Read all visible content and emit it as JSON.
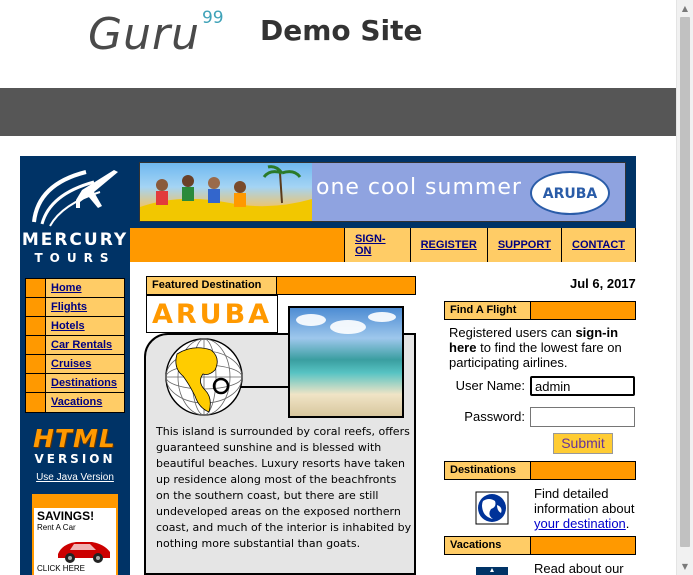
{
  "header": {
    "logo_word": "Guru",
    "logo_sup": "99",
    "site_title": "Demo Site"
  },
  "mercury": {
    "brand_line1": "MERCURY",
    "brand_line2": "TOURS",
    "banner_text": "one cool summer",
    "banner_badge": "ARUBA",
    "top_nav": [
      {
        "label": "SIGN-ON"
      },
      {
        "label": "REGISTER"
      },
      {
        "label": "SUPPORT"
      },
      {
        "label": "CONTACT"
      }
    ],
    "side_menu": [
      {
        "label": "Home"
      },
      {
        "label": "Flights"
      },
      {
        "label": "Hotels"
      },
      {
        "label": "Car Rentals"
      },
      {
        "label": "Cruises"
      },
      {
        "label": "Destinations"
      },
      {
        "label": "Vacations"
      }
    ],
    "html_version_line1": "HTML",
    "html_version_line2": "VERSION",
    "java_link": "Use Java Version",
    "savings_ad": {
      "title": "SAVINGS!",
      "subtitle": "Rent A Car",
      "cta": "CLICK HERE"
    },
    "featured": {
      "label": "Featured Destination",
      "name": "ARUBA",
      "description": "This island is surrounded by coral reefs, offers guaranteed sunshine and is blessed with beautiful beaches. Luxury resorts have taken up residence along most of the beachfronts on the southern coast, but there are still undeveloped areas on the exposed northern coast, and much of the interior is inhabited by nothing more substantial than goats."
    },
    "date": "Jul 6, 2017",
    "find_flight": {
      "label": "Find A Flight",
      "intro_pre": "Registered users can ",
      "intro_bold": "sign-in here",
      "intro_post": " to find the lowest fare on participating airlines.",
      "username_label": "User Name:",
      "username_value": "admin",
      "password_label": "Password:",
      "password_value": "",
      "submit_label": "Submit"
    },
    "destinations": {
      "label": "Destinations",
      "text_pre": "Find detailed information about ",
      "link": "your destination",
      "text_post": "."
    },
    "vacations": {
      "label": "Vacations",
      "text": "Read about our"
    }
  }
}
